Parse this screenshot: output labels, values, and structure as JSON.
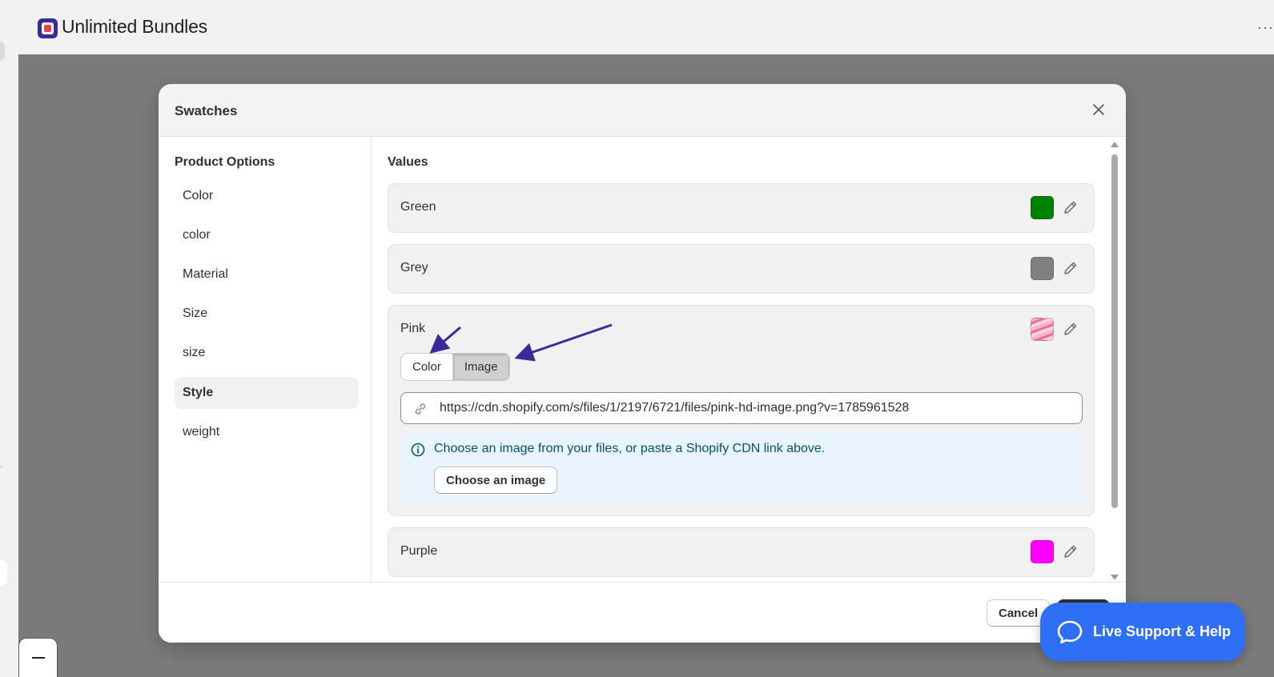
{
  "app": {
    "title": "Unlimited Bundles",
    "more_icon": "more-horizontal-icon"
  },
  "modal": {
    "title": "Swatches",
    "close_icon": "close-icon"
  },
  "product_options": {
    "heading": "Product Options",
    "items": [
      "Color",
      "color",
      "Material",
      "Size",
      "size",
      "Style",
      "weight"
    ],
    "selected": "Style"
  },
  "values": {
    "heading": "Values",
    "rows": [
      {
        "label": "Green",
        "swatch_color": "#008000"
      },
      {
        "label": "Grey",
        "swatch_color": "#808080"
      },
      {
        "label": "Pink",
        "swatch_type": "image"
      },
      {
        "label": "Purple",
        "swatch_color": "#ff00ff"
      }
    ]
  },
  "pink_editor": {
    "toggle": {
      "color_label": "Color",
      "image_label": "Image",
      "selected": "Image"
    },
    "url_value": "https://cdn.shopify.com/s/files/1/2197/6721/files/pink-hd-image.png?v=1785961528",
    "info_text": "Choose an image from your files, or paste a Shopify CDN link above.",
    "choose_button": "Choose an image"
  },
  "footer": {
    "cancel_label": "Cancel"
  },
  "live_support": {
    "label": "Live Support & Help"
  },
  "colors": {
    "accent_blue": "#2f6ff5",
    "info_bg": "#eaf4ff",
    "annotation_arrow": "#3b2a9c"
  }
}
